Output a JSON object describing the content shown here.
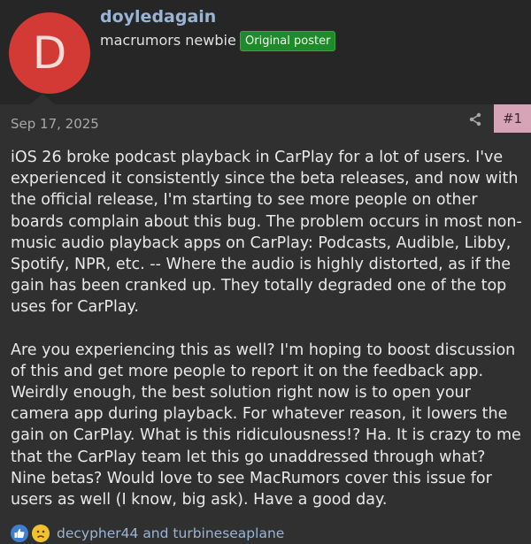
{
  "author": {
    "initial": "D",
    "username": "doyledagain",
    "title": "macrumors newbie",
    "badge": "Original poster"
  },
  "post": {
    "date": "Sep 17, 2025",
    "number": "#1",
    "paragraphs": [
      "iOS 26 broke podcast playback in CarPlay for a lot of users. I've experienced it consistently since the beta releases, and now with the official release, I'm starting to see more people on other boards complain about this bug. The problem occurs in most non-music audio playback apps on CarPlay: Podcasts, Audible, Libby, Spotify, NPR, etc. -- Where the audio is highly distorted, as if the gain has been cranked up. They totally degraded one of the top uses for CarPlay.",
      "Are you experiencing this as well? I'm hoping to boost discussion of this and get more people to report it on the feedback app. Weirdly enough, the best solution right now is to open your camera app during playback. For whatever reason, it lowers the gain on CarPlay. What is this ridiculousness!? Ha. It is crazy to me that the CarPlay team let this go unaddressed through what? Nine betas? Would love to see MacRumors cover this issue for users as well (I know, big ask). Have a good day."
    ]
  },
  "reactions": {
    "icons": [
      "like-icon",
      "sad-icon"
    ],
    "user1": "decypher44",
    "conjunction": "and",
    "user2": "turbineseaplane"
  },
  "colors": {
    "background": "#262626",
    "post_background": "#303030",
    "avatar": "#d33a36",
    "username": "#9ab4d6",
    "badge": "#1f8a2a",
    "post_number": "#d7a3b7"
  }
}
